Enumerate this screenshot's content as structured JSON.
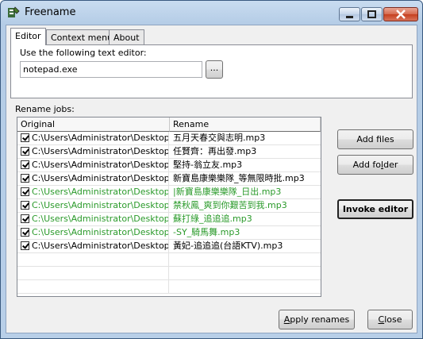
{
  "window": {
    "title": "Freename"
  },
  "tabs": [
    {
      "label": "Editor"
    },
    {
      "label": "Context menu"
    },
    {
      "label": "About"
    }
  ],
  "editor": {
    "label": "Use the following text editor:",
    "value": "notepad.exe",
    "browse_label": "..."
  },
  "jobs": {
    "label": "Rename jobs:",
    "columns": [
      "Original",
      "Rename"
    ],
    "rows": [
      {
        "original": "C:\\Users\\Administrator\\Desktop\\...",
        "rename": "五月天春交與志明.mp3",
        "checked": true,
        "highlight": false
      },
      {
        "original": "C:\\Users\\Administrator\\Desktop\\...",
        "rename": "任賢齊：再出發.mp3",
        "checked": true,
        "highlight": false
      },
      {
        "original": "C:\\Users\\Administrator\\Desktop\\...",
        "rename": "堅持-翁立友.mp3",
        "checked": true,
        "highlight": false
      },
      {
        "original": "C:\\Users\\Administrator\\Desktop\\...",
        "rename": "新寶島康樂樂隊_等無限時批.mp3",
        "checked": true,
        "highlight": false
      },
      {
        "original": "C:\\Users\\Administrator\\Desktop\\...",
        "rename": "|新寶島康樂樂隊_日出.mp3",
        "checked": true,
        "highlight": true
      },
      {
        "original": "C:\\Users\\Administrator\\Desktop\\...",
        "rename": "禁秋鳳_爽到你艱苦到我.mp3",
        "checked": true,
        "highlight": true
      },
      {
        "original": "C:\\Users\\Administrator\\Desktop\\...",
        "rename": "蘇打綠_追追追.mp3",
        "checked": true,
        "highlight": true
      },
      {
        "original": "C:\\Users\\Administrator\\Desktop\\...",
        "rename": "-SY_騎馬舞.mp3",
        "checked": true,
        "highlight": true
      },
      {
        "original": "C:\\Users\\Administrator\\Desktop\\...",
        "rename": "黃妃-追追追(台語KTV).mp3",
        "checked": true,
        "highlight": false
      }
    ]
  },
  "buttons": {
    "add_files": "Add files",
    "add_folder": "Add folder",
    "invoke_editor": "Invoke editor",
    "apply_renames": "Apply renames",
    "close": "Close"
  },
  "colors": {
    "highlight_text": "#2a9a2a",
    "titlebar": "#b4cce6",
    "close_button": "#c6401f"
  }
}
